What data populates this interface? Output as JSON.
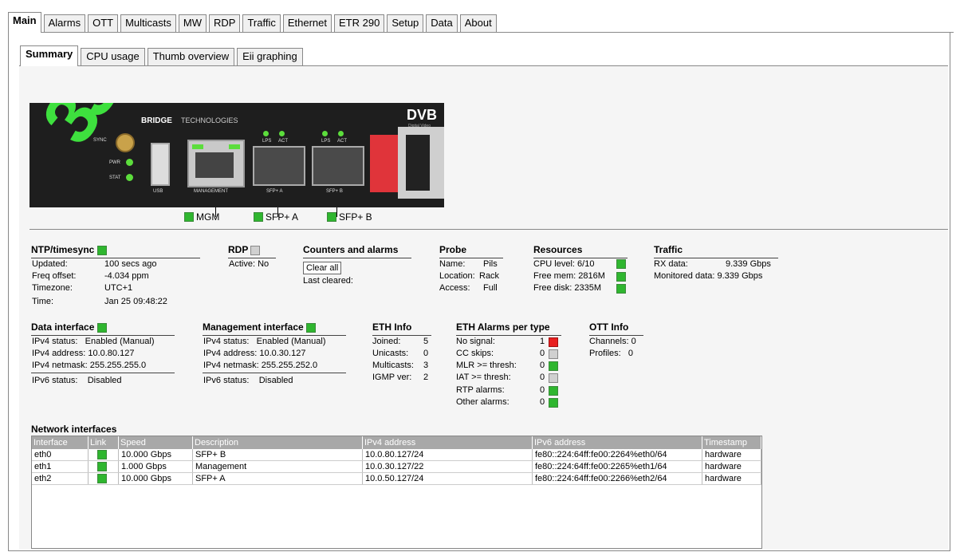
{
  "main_tabs": [
    "Main",
    "Alarms",
    "OTT",
    "Multicasts",
    "MW",
    "RDP",
    "Traffic",
    "Ethernet",
    "ETR 290",
    "Setup",
    "Data",
    "About"
  ],
  "sub_tabs": [
    "Summary",
    "CPU usage",
    "Thumb overview",
    "Eii graphing"
  ],
  "device": {
    "model": "330",
    "brand": "BRIDGE",
    "brand2": "TECHNOLOGIES",
    "dvb": "DVB",
    "dvb_sub": "Digital Video Broadcasting",
    "usb_label": "USB",
    "mgmt_label": "MANAGEMENT",
    "sfpa_label": "SFP+ A",
    "sfpb_label": "SFP+ B",
    "led_labels": [
      "SYNC",
      "PWR",
      "STAT"
    ],
    "port_led_labels": [
      "LPS",
      "ACT"
    ]
  },
  "port_status": [
    {
      "label": "MGM",
      "color": "#2fb62f"
    },
    {
      "label": "SFP+ A",
      "color": "#2fb62f"
    },
    {
      "label": "SFP+ B",
      "color": "#2fb62f"
    }
  ],
  "ntp": {
    "title": "NTP/timesync",
    "status": "green",
    "rows": [
      {
        "k": "Updated:",
        "v": "100 secs ago"
      },
      {
        "k": "Freq offset:",
        "v": "-4.034 ppm"
      },
      {
        "k": "Timezone:",
        "v": "UTC+1"
      },
      {
        "k": "Time:",
        "v": "Jan 25 09:48:22"
      }
    ]
  },
  "rdp": {
    "title": "RDP",
    "status": "grey",
    "active": "Active: No"
  },
  "counters": {
    "title": "Counters and alarms",
    "clear_label": "Clear all",
    "last_cleared": "Last cleared:"
  },
  "probe": {
    "title": "Probe",
    "rows": [
      {
        "k": "Name:",
        "v": "Pils"
      },
      {
        "k": "Location:",
        "v": "Rack"
      },
      {
        "k": "Access:",
        "v": "Full"
      }
    ]
  },
  "resources": {
    "title": "Resources",
    "rows": [
      {
        "k": "CPU level:",
        "v": "6/10"
      },
      {
        "k": "Free mem:",
        "v": "2816M"
      },
      {
        "k": "Free disk:",
        "v": "2335M"
      }
    ]
  },
  "traffic": {
    "title": "Traffic",
    "rows": [
      {
        "k": "RX data:",
        "v": "9.339 Gbps"
      },
      {
        "k": "Monitored data:",
        "v": "9.339 Gbps"
      }
    ]
  },
  "data_iface": {
    "title": "Data interface",
    "rows": [
      {
        "k": "IPv4 status:",
        "v": "Enabled (Manual)"
      },
      {
        "k": "IPv4 address:",
        "v": "10.0.80.127"
      },
      {
        "k": "IPv4 netmask:",
        "v": "255.255.255.0"
      },
      {
        "k": "IPv6 status:",
        "v": "Disabled"
      }
    ]
  },
  "mgmt_iface": {
    "title": "Management interface",
    "rows": [
      {
        "k": "IPv4 status:",
        "v": "Enabled (Manual)"
      },
      {
        "k": "IPv4 address:",
        "v": "10.0.30.127"
      },
      {
        "k": "IPv4 netmask:",
        "v": "255.255.252.0"
      },
      {
        "k": "IPv6 status:",
        "v": "Disabled"
      }
    ]
  },
  "eth_info": {
    "title": "ETH Info",
    "rows": [
      {
        "k": "Joined:",
        "v": "5"
      },
      {
        "k": "Unicasts:",
        "v": "0"
      },
      {
        "k": "Multicasts:",
        "v": "3"
      },
      {
        "k": "IGMP ver:",
        "v": "2"
      }
    ]
  },
  "eth_alarms": {
    "title": "ETH Alarms per type",
    "rows": [
      {
        "k": "No signal:",
        "v": "1",
        "status": "red"
      },
      {
        "k": "CC skips:",
        "v": "0",
        "status": "grey"
      },
      {
        "k": "MLR >= thresh:",
        "v": "0",
        "status": "green"
      },
      {
        "k": "IAT >= thresh:",
        "v": "0",
        "status": "grey"
      },
      {
        "k": "RTP alarms:",
        "v": "0",
        "status": "green"
      },
      {
        "k": "Other alarms:",
        "v": "0",
        "status": "green"
      }
    ]
  },
  "ott_info": {
    "title": "OTT Info",
    "rows": [
      {
        "k": "Channels:",
        "v": "0"
      },
      {
        "k": "Profiles:",
        "v": "0"
      }
    ]
  },
  "network": {
    "title": "Network interfaces",
    "columns": [
      "Interface",
      "Link",
      "Speed",
      "Description",
      "IPv4 address",
      "IPv6 address",
      "Timestamp"
    ],
    "rows": [
      {
        "iface": "eth0",
        "link": "green",
        "speed": "10.000 Gbps",
        "desc": "SFP+ B",
        "ipv4": "10.0.80.127/24",
        "ipv6": "fe80::224:64ff:fe00:2264%eth0/64",
        "ts": "hardware"
      },
      {
        "iface": "eth1",
        "link": "green",
        "speed": "1.000 Gbps",
        "desc": "Management",
        "ipv4": "10.0.30.127/22",
        "ipv6": "fe80::224:64ff:fe00:2265%eth1/64",
        "ts": "hardware"
      },
      {
        "iface": "eth2",
        "link": "green",
        "speed": "10.000 Gbps",
        "desc": "SFP+ A",
        "ipv4": "10.0.50.127/24",
        "ipv6": "fe80::224:64ff:fe00:2266%eth2/64",
        "ts": "hardware"
      }
    ]
  }
}
